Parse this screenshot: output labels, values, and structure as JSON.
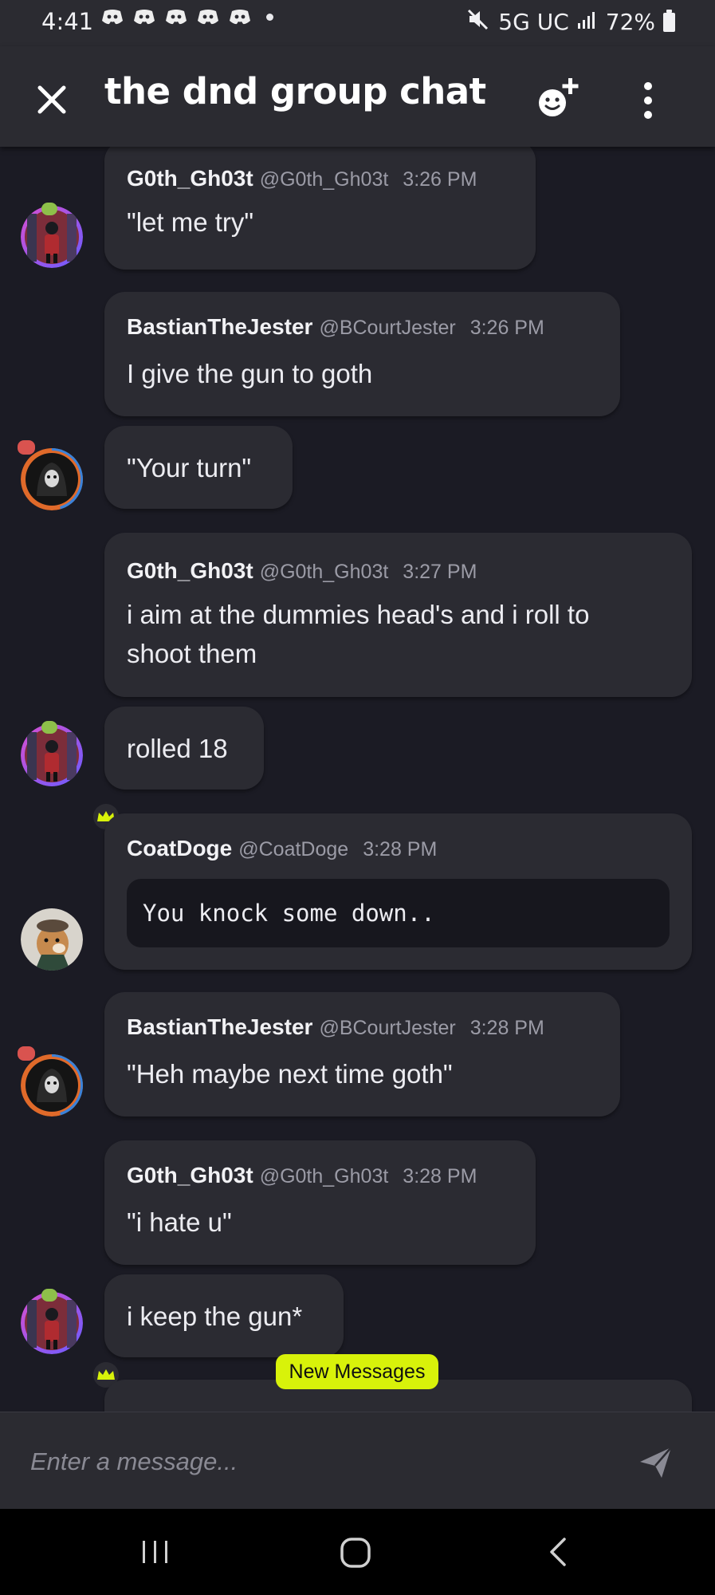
{
  "status_bar": {
    "time": "4:41",
    "network": "5G UC",
    "battery": "72%",
    "icons": [
      "discord-icon",
      "discord-icon",
      "discord-icon",
      "discord-icon",
      "discord-icon",
      "dot-icon",
      "mute-icon",
      "signal-icon",
      "battery-icon"
    ]
  },
  "header": {
    "title": "the dnd group chat",
    "close_icon": "close-icon",
    "emoji_icon": "emoji-add-icon",
    "menu_icon": "kebab-menu-icon"
  },
  "messages": [
    {
      "name": "G0th_Gh03t",
      "handle": "@G0th_Gh03t",
      "time": "3:26 PM",
      "text": "\"let me try\""
    },
    {
      "name": "BastianTheJester",
      "handle": "@BCourtJester",
      "time": "3:26 PM",
      "text": "I give the gun to goth"
    },
    {
      "text": "\"Your turn\""
    },
    {
      "name": "G0th_Gh03t",
      "handle": "@G0th_Gh03t",
      "time": "3:27 PM",
      "text_line1": "i aim at the dummies head's and i roll to",
      "text_line2": "shoot them"
    },
    {
      "text": "rolled 18"
    },
    {
      "name": "CoatDoge",
      "handle": "@CoatDoge",
      "time": "3:28 PM",
      "code": "You knock some down.."
    },
    {
      "name": "BastianTheJester",
      "handle": "@BCourtJester",
      "time": "3:28 PM",
      "text": "\"Heh maybe next time goth\""
    },
    {
      "name": "G0th_Gh03t",
      "handle": "@G0th_Gh03t",
      "time": "3:28 PM",
      "text": "\"i hate u\""
    },
    {
      "text": "i keep the gun*"
    }
  ],
  "new_messages_label": "New Messages",
  "composer": {
    "placeholder": "Enter a message..."
  },
  "colors": {
    "background": "#1b1b24",
    "bubble": "#2b2b32",
    "header": "#2b2b31",
    "new_messages_badge": "#d8f20a",
    "crown": "#d8f20a"
  }
}
